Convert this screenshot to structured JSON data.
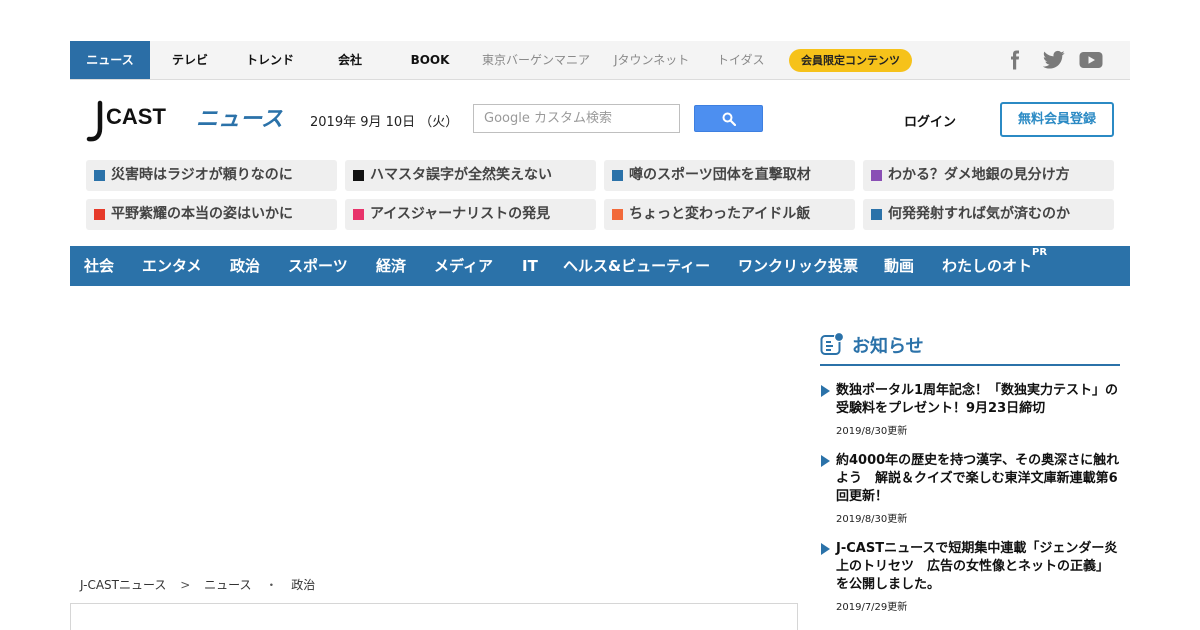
{
  "topbar": {
    "tabs": [
      {
        "label": "ニュース"
      },
      {
        "label": "テレビ"
      },
      {
        "label": "トレンド"
      },
      {
        "label": "会社"
      },
      {
        "label": "BOOK"
      }
    ],
    "external_links": [
      {
        "label": "東京バーゲンマニア"
      },
      {
        "label": "Jタウンネット"
      },
      {
        "label": "トイダス"
      }
    ],
    "member_badge": "会員限定コンテンツ",
    "social_icons": [
      "facebook-icon",
      "twitter-icon",
      "youtube-icon"
    ]
  },
  "header": {
    "logo_text_main": "CAST",
    "logo_text_sub": "ニュース",
    "date": "2019年 9月 10日 （火）",
    "search_placeholder": "Google カスタム検索",
    "login_label": "ログイン",
    "register_label": "無料会員登録"
  },
  "topics": [
    {
      "label": "災害時はラジオが頼りなのに",
      "color": "#2b72a9"
    },
    {
      "label": "ハマスタ誤字が全然笑えない",
      "color": "#111111"
    },
    {
      "label": "噂のスポーツ団体を直撃取材",
      "color": "#2b72a9"
    },
    {
      "label": "わかる？ダメ地銀の見分け方",
      "color": "#8a4fb5"
    },
    {
      "label": "平野紫耀の本当の姿はいかに",
      "color": "#e63a2a"
    },
    {
      "label": "アイスジャーナリストの発見",
      "color": "#e8336b"
    },
    {
      "label": "ちょっと変わったアイドル飯",
      "color": "#f26a3a"
    },
    {
      "label": "何発発射すれば気が済むのか",
      "color": "#2b72a9"
    }
  ],
  "main_nav": {
    "items": [
      {
        "label": "社会"
      },
      {
        "label": "エンタメ"
      },
      {
        "label": "政治"
      },
      {
        "label": "スポーツ"
      },
      {
        "label": "経済"
      },
      {
        "label": "メディア"
      },
      {
        "label": "IT"
      },
      {
        "label": "ヘルス&ビューティー"
      },
      {
        "label": "ワンクリック投票"
      },
      {
        "label": "動画"
      },
      {
        "label": "わたしのオト"
      }
    ],
    "pr_badge": "PR"
  },
  "breadcrumb": {
    "home": "J-CASTニュース",
    "sep1": ">",
    "section": "ニュース",
    "sep2": "・",
    "category": "政治"
  },
  "notices": {
    "title": "お知らせ",
    "items": [
      {
        "text": "数独ポータル1周年記念！「数独実力テスト」の受験料をプレゼント！9月23日締切",
        "date": "2019/8/30更新"
      },
      {
        "text": "約4000年の歴史を持つ漢字、その奥深さに触れよう　解説＆クイズで楽しむ東洋文庫新連載第6回更新！",
        "date": "2019/8/30更新"
      },
      {
        "text": "J-CASTニュースで短期集中連載「ジェンダー炎上のトリセツ　広告の女性像とネットの正義」を公開しました。",
        "date": "2019/7/29更新"
      }
    ]
  },
  "colors": {
    "brand_blue": "#2b72a9",
    "badge_yellow": "#f6c21a",
    "search_blue": "#4d8ff0"
  }
}
